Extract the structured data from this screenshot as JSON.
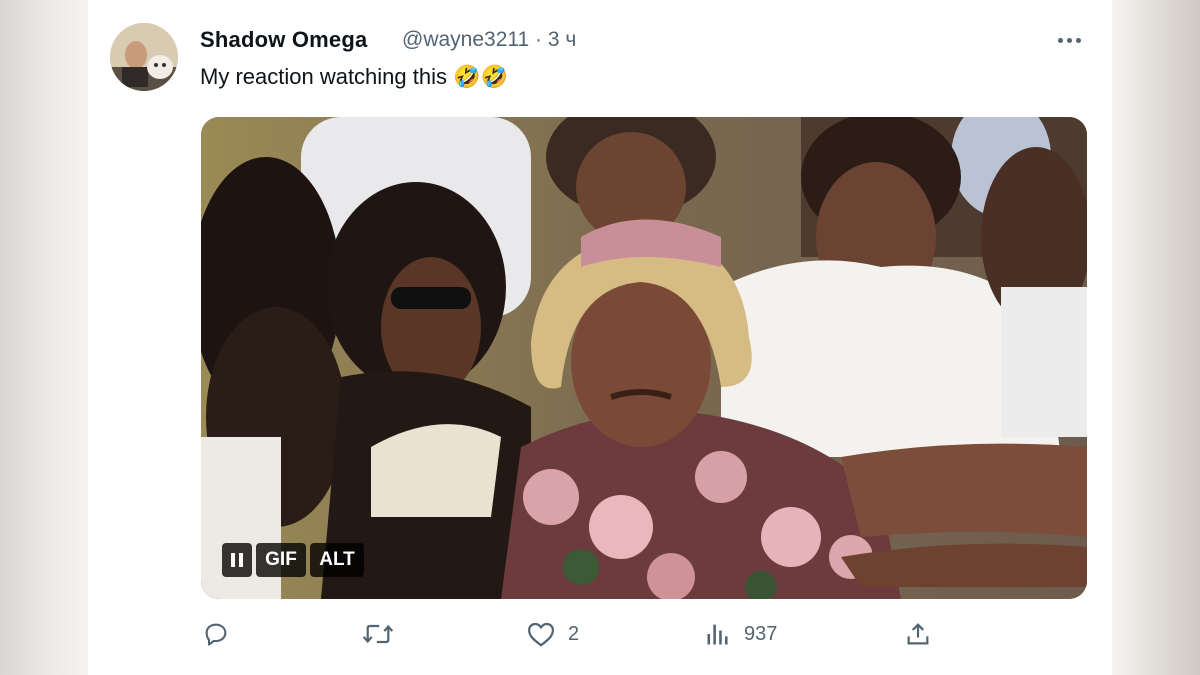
{
  "tweet": {
    "author_name": "Shadow Omega",
    "author_handle": "@wayne3211 · 3 ч",
    "text": "My reaction watching this 🤣🤣",
    "more_icon": "more-horizontal-icon"
  },
  "media": {
    "pause_icon": "pause-icon",
    "gif_label": "GIF",
    "alt_label": "ALT"
  },
  "actions": {
    "reply_icon": "reply-icon",
    "retweet_icon": "retweet-icon",
    "like_icon": "heart-icon",
    "like_count": "2",
    "views_icon": "views-icon",
    "views_count": "937",
    "share_icon": "share-icon"
  },
  "colors": {
    "text": "#0f1419",
    "secondary": "#536471",
    "background": "#ffffff"
  }
}
